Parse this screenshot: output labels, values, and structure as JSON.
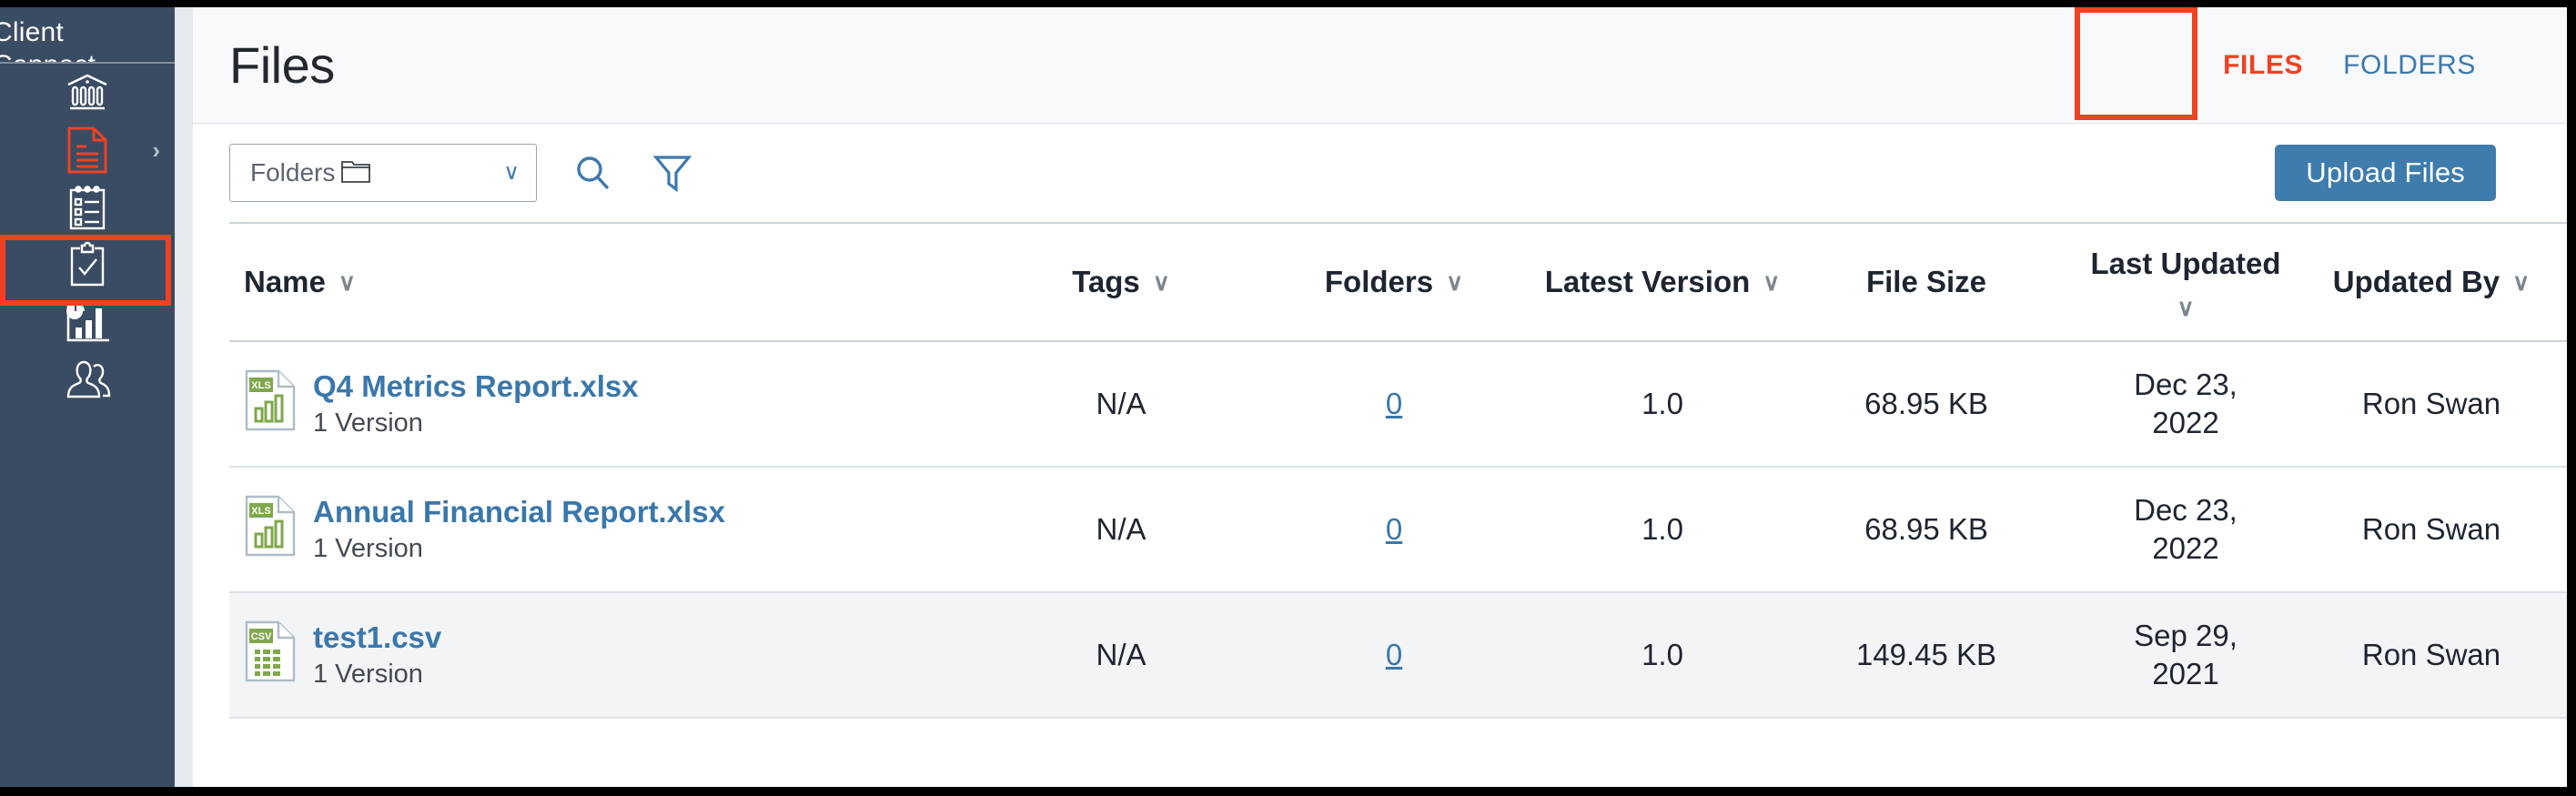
{
  "app": {
    "brand_line1": "Client",
    "brand_line2": "Connect"
  },
  "sidebar": {
    "items": [
      {
        "icon": "bank-icon",
        "name": "bank",
        "active": false
      },
      {
        "icon": "document-icon",
        "name": "documents",
        "active": true,
        "chevron": "›"
      },
      {
        "icon": "checklist-icon",
        "name": "checklist",
        "active": false
      },
      {
        "icon": "clipboard-check-icon",
        "name": "tasks",
        "active": false
      },
      {
        "icon": "reports-chart-icon",
        "name": "reports",
        "active": false
      },
      {
        "icon": "users-icon",
        "name": "contacts",
        "active": false
      }
    ]
  },
  "header": {
    "title": "Files",
    "tabs": [
      {
        "label": "FILES",
        "active": true
      },
      {
        "label": "FOLDERS",
        "active": false
      }
    ]
  },
  "toolbar": {
    "folder_select_label": "Folders",
    "folder_select_caret": "∨",
    "search_icon": "search-icon",
    "filter_icon": "filter-icon",
    "upload_label": "Upload Files"
  },
  "table": {
    "columns": [
      {
        "label": "Name",
        "sortable": true,
        "align": "left"
      },
      {
        "label": "Tags",
        "sortable": true,
        "align": "center"
      },
      {
        "label": "Folders",
        "sortable": true,
        "align": "center"
      },
      {
        "label": "Latest Version",
        "sortable": true,
        "align": "center"
      },
      {
        "label": "File Size",
        "sortable": false,
        "align": "center"
      },
      {
        "label": "Last Updated",
        "sortable": true,
        "align": "center"
      },
      {
        "label": "Updated By",
        "sortable": true,
        "align": "center"
      },
      {
        "label": "",
        "sortable": false,
        "align": "center"
      }
    ],
    "chevron": "∨",
    "rows": [
      {
        "file_type": "xls",
        "name": "Q4 Metrics Report.xlsx",
        "versions": "1 Version",
        "tags": "N/A",
        "folders": "0",
        "latest_version": "1.0",
        "file_size": "68.95 KB",
        "last_updated_line1": "Dec 23,",
        "last_updated_line2": "2022",
        "updated_by": "Ron Swan",
        "highlighted": false
      },
      {
        "file_type": "xls",
        "name": "Annual Financial Report.xlsx",
        "versions": "1 Version",
        "tags": "N/A",
        "folders": "0",
        "latest_version": "1.0",
        "file_size": "68.95 KB",
        "last_updated_line1": "Dec 23,",
        "last_updated_line2": "2022",
        "updated_by": "Ron Swan",
        "highlighted": false
      },
      {
        "file_type": "csv",
        "name": "test1.csv",
        "versions": "1 Version",
        "tags": "N/A",
        "folders": "0",
        "latest_version": "1.0",
        "file_size": "149.45 KB",
        "last_updated_line1": "Sep 29,",
        "last_updated_line2": "2021",
        "updated_by": "Ron Swan",
        "highlighted": true
      }
    ]
  },
  "colors": {
    "sidebar_bg": "#3a4c63",
    "accent_orange": "#ef4123",
    "link_blue": "#3a77ab",
    "button_blue": "#3d7cac",
    "tab_inactive_blue": "#3e79ad",
    "file_icon_green": "#7fa84c"
  }
}
